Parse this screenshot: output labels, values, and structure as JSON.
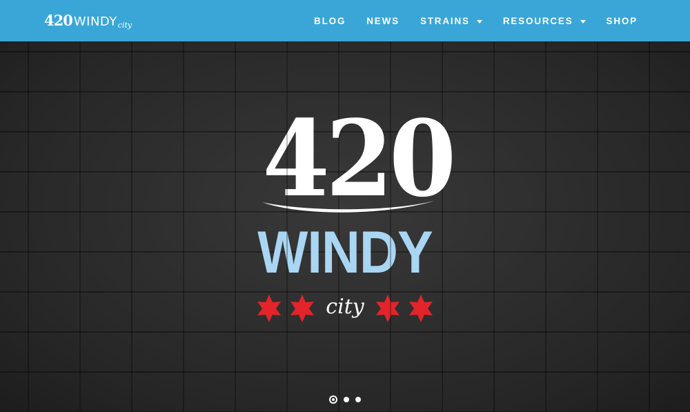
{
  "colors": {
    "navbar": "#3aa6d8",
    "nav_text": "#ffffff",
    "hero_bg": "#2d2d2d",
    "logo_white": "#ffffff",
    "logo_blue": "#a9d6f2",
    "star_red": "#e3242b"
  },
  "header": {
    "brand": {
      "num": "420",
      "word": "WINDY",
      "city": "city"
    },
    "nav": [
      {
        "label": "BLOG",
        "dropdown": false,
        "icon": null
      },
      {
        "label": "NEWS",
        "dropdown": false,
        "icon": null
      },
      {
        "label": "STRAINS",
        "dropdown": true,
        "icon": "caret-down-icon"
      },
      {
        "label": "RESOURCES",
        "dropdown": true,
        "icon": "caret-down-icon"
      },
      {
        "label": "SHOP",
        "dropdown": false,
        "icon": null
      }
    ]
  },
  "hero": {
    "logo": {
      "number": "420",
      "word": "WINDY",
      "script": "city",
      "icons": [
        "six-point-star-icon",
        "six-point-star-icon",
        "six-point-star-icon",
        "six-point-star-icon"
      ]
    },
    "slider": {
      "slide_count": 3,
      "active_index": 1
    }
  }
}
